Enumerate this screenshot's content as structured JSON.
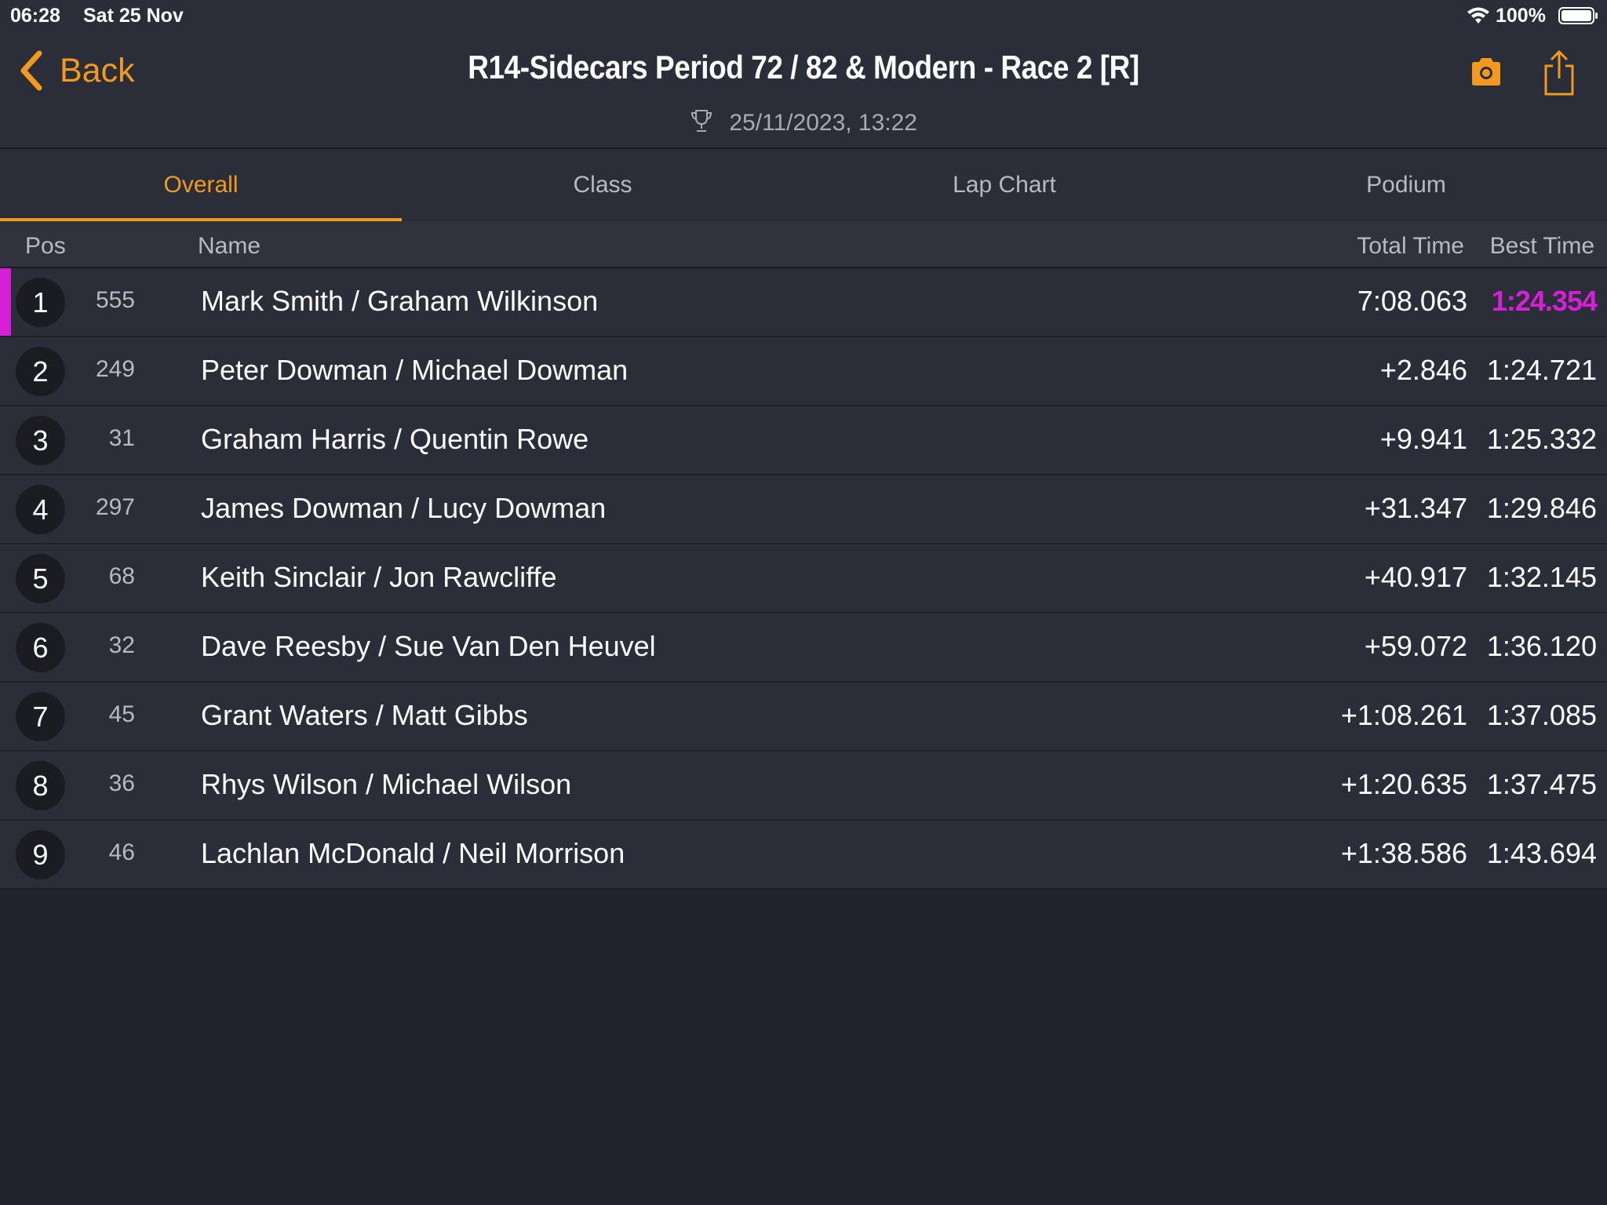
{
  "status_bar": {
    "time": "06:28",
    "date": "Sat 25 Nov",
    "battery": "100%"
  },
  "header": {
    "back_label": "Back",
    "title": "R14-Sidecars Period 72 / 82 & Modern - Race 2 [R]",
    "timestamp": "25/11/2023, 13:22"
  },
  "tabs": [
    {
      "label": "Overall",
      "active": true
    },
    {
      "label": "Class",
      "active": false
    },
    {
      "label": "Lap Chart",
      "active": false
    },
    {
      "label": "Podium",
      "active": false
    }
  ],
  "columns": {
    "pos": "Pos",
    "name": "Name",
    "total_time": "Total Time",
    "best_time": "Best Time"
  },
  "results": [
    {
      "pos": "1",
      "number": "555",
      "name": "Mark Smith / Graham Wilkinson",
      "total": "7:08.063",
      "best": "1:24.354",
      "fastest": true
    },
    {
      "pos": "2",
      "number": "249",
      "name": "Peter Dowman / Michael Dowman",
      "total": "+2.846",
      "best": "1:24.721"
    },
    {
      "pos": "3",
      "number": "31",
      "name": "Graham Harris / Quentin Rowe",
      "total": "+9.941",
      "best": "1:25.332"
    },
    {
      "pos": "4",
      "number": "297",
      "name": "James Dowman / Lucy Dowman",
      "total": "+31.347",
      "best": "1:29.846"
    },
    {
      "pos": "5",
      "number": "68",
      "name": "Keith Sinclair / Jon Rawcliffe",
      "total": "+40.917",
      "best": "1:32.145"
    },
    {
      "pos": "6",
      "number": "32",
      "name": "Dave Reesby / Sue Van Den Heuvel",
      "total": "+59.072",
      "best": "1:36.120"
    },
    {
      "pos": "7",
      "number": "45",
      "name": "Grant Waters / Matt Gibbs",
      "total": "+1:08.261",
      "best": "1:37.085"
    },
    {
      "pos": "8",
      "number": "36",
      "name": "Rhys Wilson / Michael Wilson",
      "total": "+1:20.635",
      "best": "1:37.475"
    },
    {
      "pos": "9",
      "number": "46",
      "name": "Lachlan McDonald / Neil Morrison",
      "total": "+1:38.586",
      "best": "1:43.694"
    }
  ],
  "colors": {
    "accent": "#f39a1e",
    "fastest_lap": "#d81fd8",
    "background": "#20232b",
    "panel": "#2a2e38"
  },
  "icons": [
    "wifi-icon",
    "battery-icon",
    "chevron-left-icon",
    "trophy-icon",
    "camera-icon",
    "share-icon"
  ]
}
